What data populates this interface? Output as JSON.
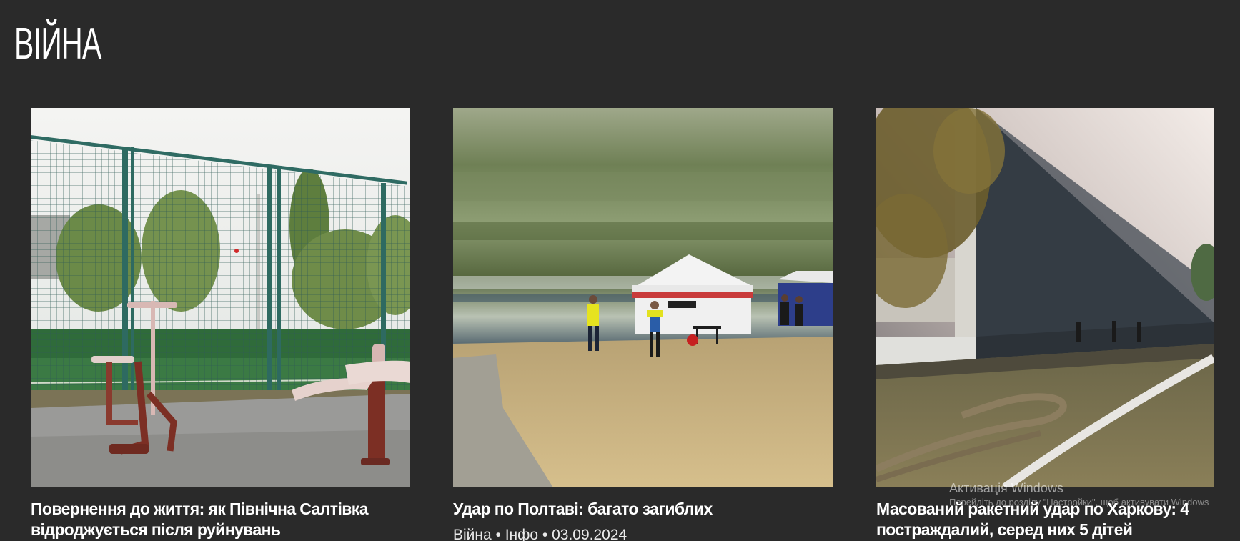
{
  "section": {
    "title": "ВІЙНА"
  },
  "cards": [
    {
      "title": "Повернення до життя: як Північна Салтівка\nвідроджується після руйнувань",
      "image_alt": "Outdoor gym equipment beside a green fenced sports field"
    },
    {
      "title": "Удар по Полтаві: багато загиблих",
      "meta": "Війна • Інфо • 03.09.2024",
      "image_alt": "Emergency workers beside white tents on a dry lawn"
    },
    {
      "title": "Масований ракетний удар по Харкову: 4\nпостраждалий, серед них 5 дітей",
      "image_alt": "Burning building with fire hoses on the ground"
    }
  ],
  "watermark": {
    "title": "Активація Windows",
    "subtitle": "Перейдіть до розділу \"Настройки\", щоб активувати Windows"
  },
  "colors": {
    "background": "#2a2a2a",
    "text": "#ffffff"
  }
}
